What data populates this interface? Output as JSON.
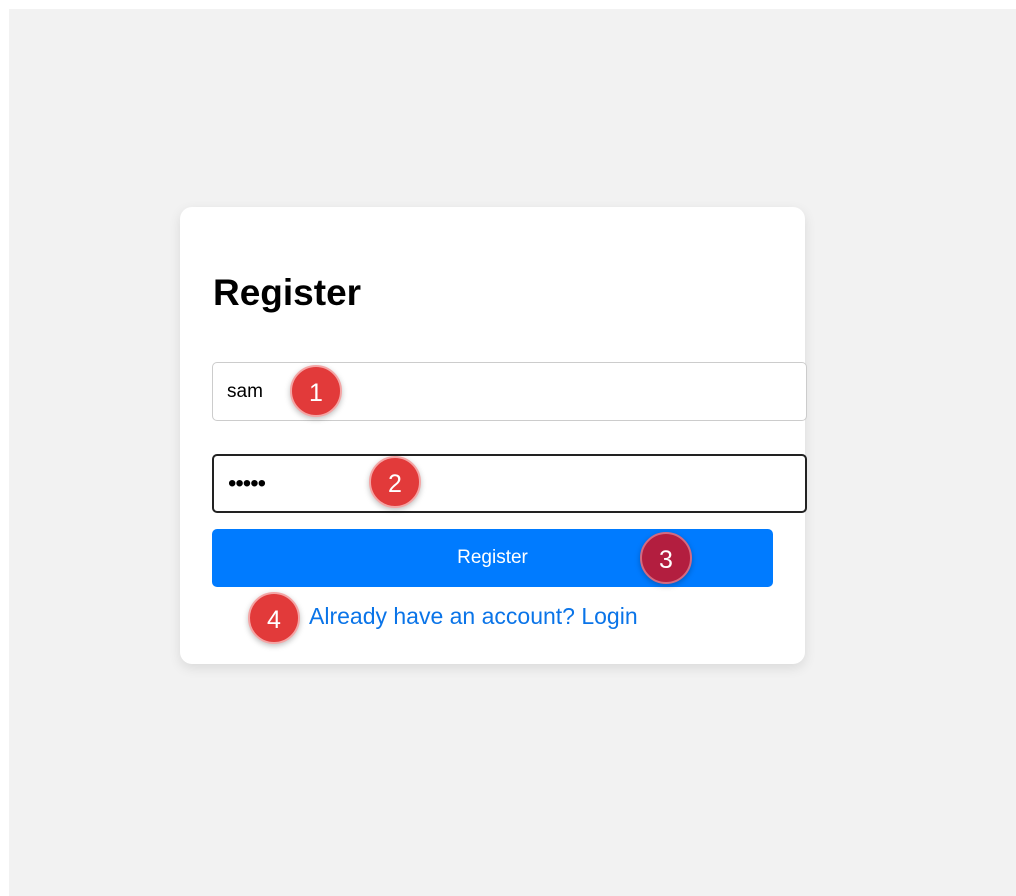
{
  "form": {
    "title": "Register",
    "username_value": "sam",
    "password_value": "•••••",
    "submit_label": "Register",
    "login_link": "Already have an account? Login"
  },
  "markers": [
    "1",
    "2",
    "3",
    "4"
  ],
  "colors": {
    "page_background": "#f2f2f2",
    "card_background": "#ffffff",
    "button_background": "#007bff",
    "link": "#0a74e8",
    "marker": "#e23a3a",
    "marker_active": "#b31e3f"
  }
}
